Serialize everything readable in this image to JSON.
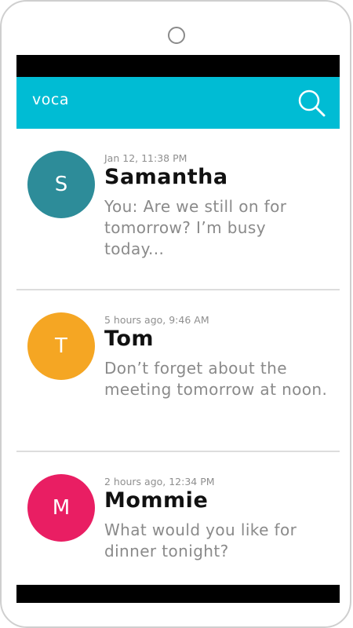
{
  "app": {
    "title": "voca"
  },
  "icons": {
    "search": "search-icon"
  },
  "colors": {
    "app_bar": "#00bcd4",
    "status_bar": "#000000",
    "avatar_samantha": "#2d8c99",
    "avatar_tom": "#f5a623",
    "avatar_mommie": "#e91e63"
  },
  "conversations": [
    {
      "initial": "S",
      "time": "Jan 12, 11:38 PM",
      "name": "Samantha",
      "preview": "You: Are we still on for tomorrow? I’m busy today..."
    },
    {
      "initial": "T",
      "time": "5 hours ago, 9:46 AM",
      "name": "Tom",
      "preview": "Don’t forget about the meeting tomorrow at noon."
    },
    {
      "initial": "M",
      "time": "2 hours ago, 12:34 PM",
      "name": "Mommie",
      "preview": "What would you like for dinner tonight?"
    }
  ]
}
